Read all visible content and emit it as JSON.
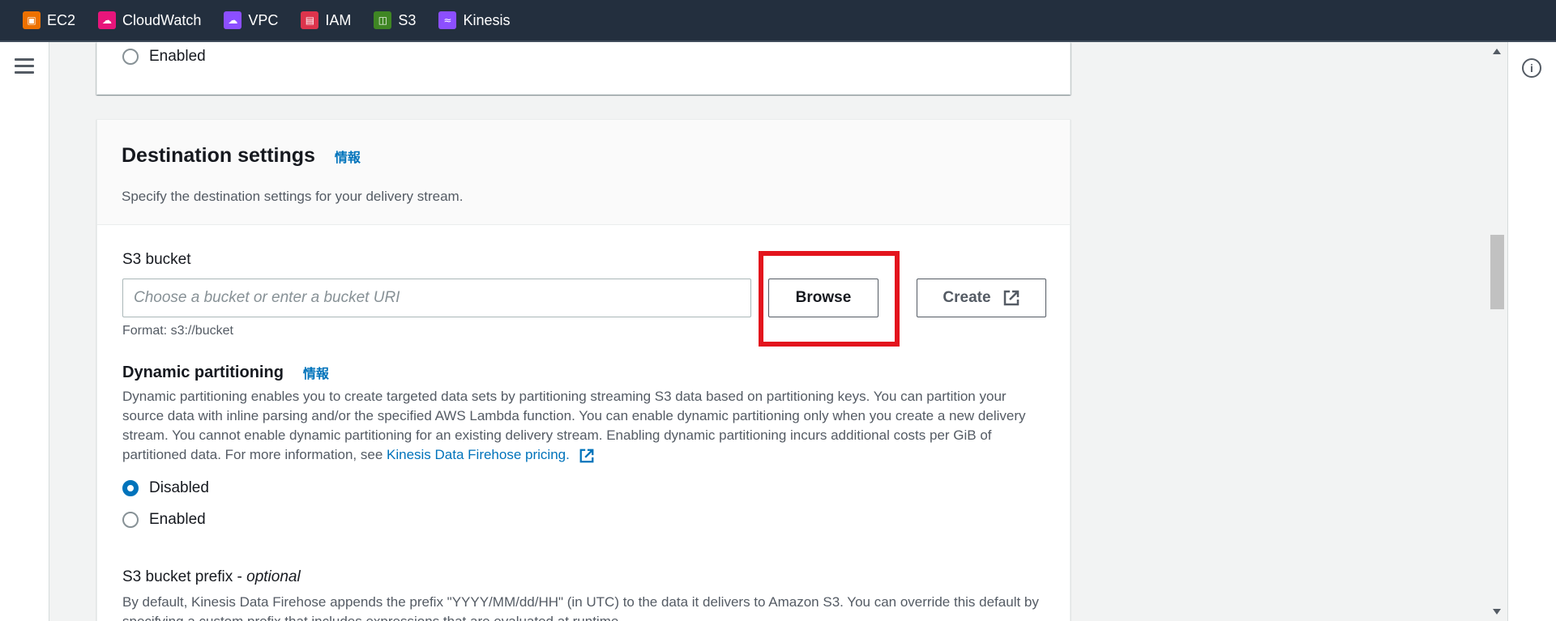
{
  "services": [
    {
      "label": "EC2",
      "color": "#ed7100",
      "icon": "ec2-icon"
    },
    {
      "label": "CloudWatch",
      "color": "#e7157b",
      "icon": "cloudwatch-icon"
    },
    {
      "label": "VPC",
      "color": "#8c4fff",
      "icon": "vpc-icon"
    },
    {
      "label": "IAM",
      "color": "#dd344c",
      "icon": "iam-icon"
    },
    {
      "label": "S3",
      "color": "#3f8624",
      "icon": "s3-icon"
    },
    {
      "label": "Kinesis",
      "color": "#8c4fff",
      "icon": "kinesis-icon"
    }
  ],
  "previous_section": {
    "enabled_label": "Enabled"
  },
  "destination": {
    "title": "Destination settings",
    "info": "情報",
    "description": "Specify the destination settings for your delivery stream.",
    "s3_bucket_label": "S3 bucket",
    "s3_bucket_placeholder": "Choose a bucket or enter a bucket URI",
    "s3_bucket_value": "",
    "browse_label": "Browse",
    "create_label": "Create",
    "format_hint": "Format: s3://bucket",
    "dynamic_partitioning": {
      "title": "Dynamic partitioning",
      "info": "情報",
      "description": "Dynamic partitioning enables you to create targeted data sets by partitioning streaming S3 data based on partitioning keys. You can partition your source data with inline parsing and/or the specified AWS Lambda function. You can enable dynamic partitioning only when you create a new delivery stream. You cannot enable dynamic partitioning for an existing delivery stream. Enabling dynamic partitioning incurs additional costs per GiB of partitioned data. For more information, see ",
      "link_text": "Kinesis Data Firehose pricing.",
      "options": [
        "Disabled",
        "Enabled"
      ],
      "selected": "Disabled"
    },
    "prefix": {
      "title": "S3 bucket prefix - ",
      "title_optional": "optional",
      "description": "By default, Kinesis Data Firehose appends the prefix \"YYYY/MM/dd/HH\" (in UTC) to the data it delivers to Amazon S3. You can override this default by specifying a custom prefix that includes expressions that are evaluated at runtime."
    }
  },
  "colors": {
    "topbar": "#232f3e",
    "link": "#0073bb",
    "highlight": "#e3141d"
  }
}
